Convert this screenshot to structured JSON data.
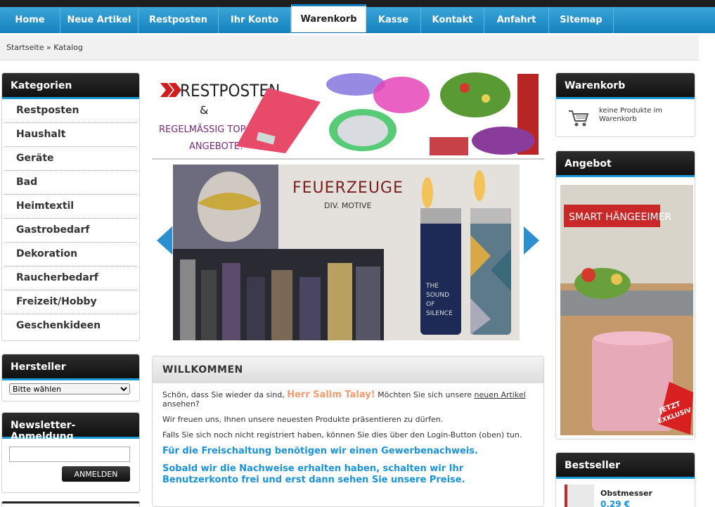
{
  "nav": {
    "items": [
      "Home",
      "Neue Artikel",
      "Restposten",
      "Ihr Konto",
      "Warenkorb",
      "Kasse",
      "Kontakt",
      "Anfahrt",
      "Sitemap"
    ],
    "active": "Warenkorb"
  },
  "breadcrumb": {
    "home": "Startseite",
    "sep": " » ",
    "current": "Katalog"
  },
  "categories": {
    "title": "Kategorien",
    "items": [
      "Restposten",
      "Haushalt",
      "Geräte",
      "Bad",
      "Heimtextil",
      "Gastrobedarf",
      "Dekoration",
      "Raucherbedarf",
      "Freizeit/Hobby",
      "Geschenkideen"
    ]
  },
  "manufacturer": {
    "title": "Hersteller",
    "selected": "Bitte wählen"
  },
  "newsletter": {
    "title": "Newsletter-Anmeldung",
    "button": "ANMELDEN"
  },
  "banner_top": {
    "title": "RESTPOSTEN",
    "amp": "&",
    "line1": "REGELMÄSSIG TOP",
    "line2": "ANGEBOTE!"
  },
  "slider": {
    "title": "FEUERZEUGE",
    "subtitle": "DIV. MOTIVE",
    "lighter_text": [
      "THE",
      "SOUND",
      "OF",
      "SILENCE"
    ]
  },
  "welcome": {
    "title": "WILLKOMMEN",
    "greeting_pre": "Schön, dass Sie wieder da sind, ",
    "user_name": "Herr Salim Talay!",
    "greeting_mid": " Möchten Sie sich unsere ",
    "greeting_link": "neuen Artikel",
    "greeting_post": " ansehen?",
    "p2": "Wir freuen uns, Ihnen unsere neuesten Produkte präsentieren zu dürfen.",
    "p3": "Falls Sie sich noch nicht registriert haben, können Sie dies über den Login-Button (oben) tun.",
    "b1": "Für die Freischaltung benötigen wir einen Gewerbenachweis.",
    "b2": "Sobald wir die Nachweise erhalten haben, schalten wir Ihr Benutzerkonto frei und erst dann sehen Sie unsere Preise."
  },
  "cart": {
    "title": "Warenkorb",
    "empty_line1": "keine Produkte im",
    "empty_line2": "Warenkorb"
  },
  "offer": {
    "title": "Angebot",
    "label": "SMART HÄNGEEIMER",
    "badge_line1": "JETZT",
    "badge_line2": "EXKLUSIV"
  },
  "bestseller": {
    "title": "Bestseller",
    "product": "Obstmesser",
    "price": "0,29 €"
  },
  "colors": {
    "nav": "#1583bf",
    "accent_blue": "#1a93d8",
    "orange": "#f39a6e",
    "dark": "#111111"
  }
}
